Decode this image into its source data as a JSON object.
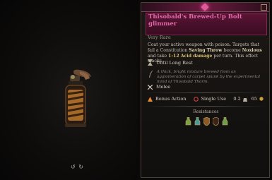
{
  "viewer": {
    "rotate_hint": "↺ ↻"
  },
  "item": {
    "name": "Thisobald's Brewed-Up Bolt glimmer",
    "rarity": "Very Rare",
    "description": {
      "part1": "Coat your active weapon with poison. Targets that fail a Constitution ",
      "saving_throw": "Saving Throw",
      "part2": " become ",
      "condition": "Noxious",
      "part3": " and take ",
      "damage": "1-12 Acid damage",
      "part4": " per turn. This effect stacks."
    },
    "duration": "Until Long Rest",
    "flavor": "A thick, bright mixture brewed from an agglomeration of carpet spunk by the experimental mind of Thisobald Thorm.",
    "range": "Melee",
    "action": "Bonus Action",
    "usage": "Single Use",
    "weight": "0.2",
    "value": "65",
    "resistances_label": "Resistances",
    "colors": {
      "accent": "#e06aa8",
      "title_bg": "#5a1434",
      "action": "#e08a3a",
      "usage": "#c04040"
    }
  }
}
